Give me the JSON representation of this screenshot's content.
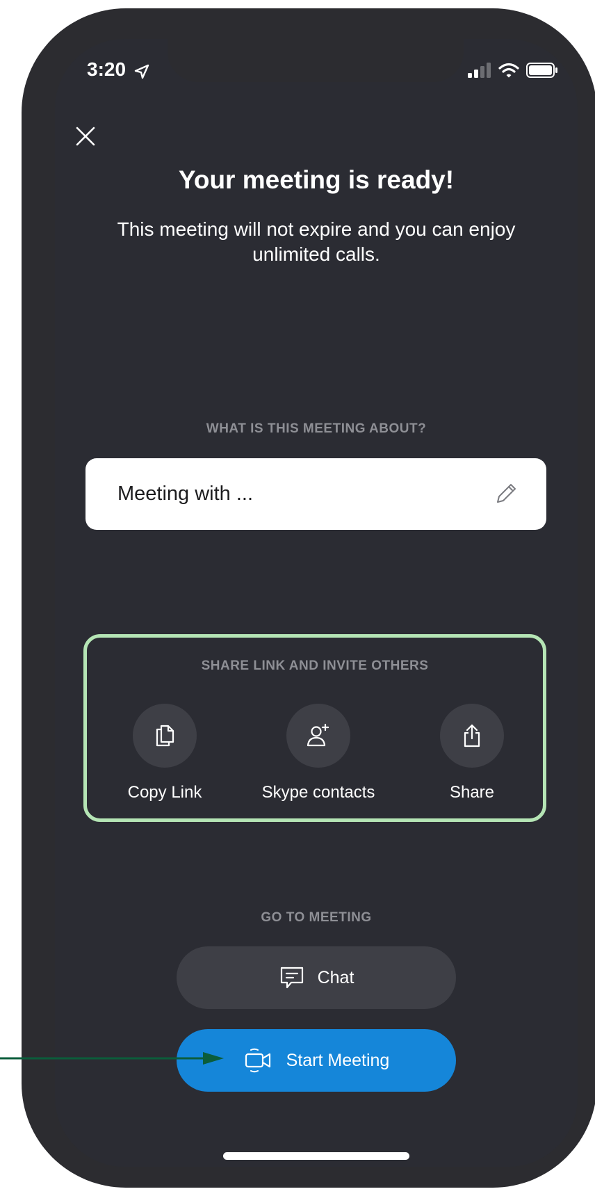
{
  "status_bar": {
    "time": "3:20",
    "icons": [
      "location-arrow-icon",
      "signal-icon",
      "wifi-icon",
      "battery-icon"
    ]
  },
  "header": {
    "close_icon": "close-icon",
    "title": "Your meeting is ready!",
    "subtitle": "This meeting will not expire and you can enjoy unlimited calls."
  },
  "topic": {
    "label": "WHAT IS THIS MEETING ABOUT?",
    "value": "Meeting with ...",
    "icon": "pencil-icon"
  },
  "share": {
    "label": "SHARE LINK AND INVITE OTHERS",
    "items": [
      {
        "label": "Copy Link",
        "icon": "copy-icon"
      },
      {
        "label": "Skype contacts",
        "icon": "add-contact-icon"
      },
      {
        "label": "Share",
        "icon": "share-icon"
      }
    ]
  },
  "go": {
    "label": "GO TO MEETING",
    "chat_label": "Chat",
    "start_label": "Start Meeting"
  },
  "colors": {
    "screen_bg": "#2b2c33",
    "accent_blue": "#1586d9",
    "highlight_green": "#b5e5b5",
    "annotation_arrow": "#0b5d3b"
  }
}
